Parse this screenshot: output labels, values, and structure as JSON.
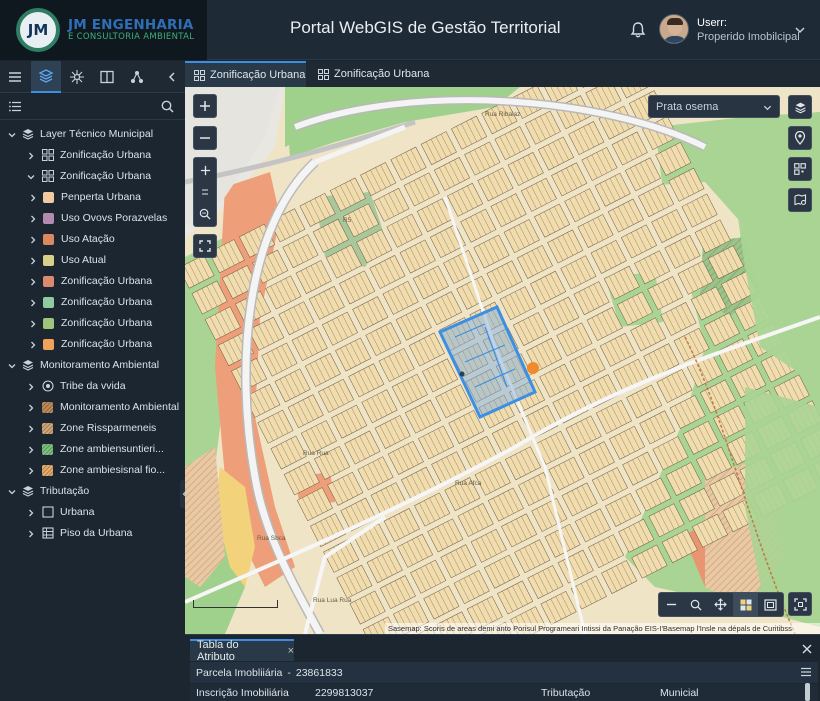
{
  "app": {
    "logo_title": "JM ENGENHARIA",
    "logo_subtitle": "E CONSULTORIA AMBIENTAL",
    "logo_initials": "JM",
    "title": "Portal WebGIS de Gestão Territorial"
  },
  "user": {
    "name": "Userr:",
    "role": "Properido Imobilcipal"
  },
  "tabs": [
    {
      "label": "Zonificação Urbana",
      "active": true
    },
    {
      "label": "Zonificação Urbana",
      "active": false
    }
  ],
  "toolbar": {
    "icons": [
      "menu-icon",
      "layers-icon",
      "network-icon",
      "split-view-icon",
      "tree-icon",
      "collapse-left-icon"
    ]
  },
  "layers": [
    {
      "label": "Layer Técnico Municipal",
      "level": 0,
      "expanded": true,
      "icon": "stack-icon"
    },
    {
      "label": "Zonificação Urbana",
      "level": 1,
      "expanded": false,
      "icon": "grid-icon"
    },
    {
      "label": "Zonificação Urbana",
      "level": 1,
      "expanded": true,
      "icon": "grid-icon"
    },
    {
      "label": "Penperta Urbana",
      "level": 2,
      "color": "#f2c9a0"
    },
    {
      "label": "Uso Ovovs Porazvelas",
      "level": 2,
      "color": "#b48ab0"
    },
    {
      "label": "Uso Atação",
      "level": 2,
      "color": "#d9895f"
    },
    {
      "label": "Uso Atual",
      "level": 2,
      "color": "#d8cf8a"
    },
    {
      "label": "Zonificação Urbana",
      "level": 2,
      "color": "#d98a6f"
    },
    {
      "label": "Zonificação Urbana",
      "level": 2,
      "color": "#8fcaa2"
    },
    {
      "label": "Zonificação Urbana",
      "level": 2,
      "color": "#9ec57a"
    },
    {
      "label": "Zonificação Urbana",
      "level": 2,
      "color": "#f0a25a"
    },
    {
      "label": "Monitoramento Ambiental",
      "level": 0,
      "expanded": true,
      "icon": "stack-icon"
    },
    {
      "label": "Tribe da vvida",
      "level": 1,
      "icon": "target-icon"
    },
    {
      "label": "Monitoramento Ambiental",
      "level": 1,
      "color": "#c0895a",
      "hatched": true
    },
    {
      "label": "Zone Rissparmeneis",
      "level": 1,
      "color": "#d2a777",
      "hatched": true
    },
    {
      "label": "Zone ambiensuntieri...",
      "level": 1,
      "color": "#7cc27f",
      "hatched": true
    },
    {
      "label": "Zone ambiesisnal fio...",
      "level": 1,
      "color": "#e6ad6b",
      "hatched": true
    },
    {
      "label": "Tributação",
      "level": 0,
      "expanded": true,
      "icon": "stack-icon"
    },
    {
      "label": "Urbana",
      "level": 1,
      "icon": "square-icon"
    },
    {
      "label": "Piso da Urbana",
      "level": 1,
      "icon": "table-icon"
    }
  ],
  "map": {
    "basemap_value": "Prata osema",
    "attribution": "Sasemap: Scoris de areas demi anto Porisul Programeari Intissi da Panação EIS-I'Basemap l'Insle na dépals de Curitibss",
    "labels": [
      "R5",
      "Rua Ribalaz",
      "Rua Rua",
      "Rua Afca",
      "Rua Sbca",
      "Rua Lua Rua"
    ]
  },
  "attribute_table": {
    "tab_label": "Tabla do Atributo",
    "header_label": "Parcela Imobliiária",
    "header_value": "23861833",
    "row": {
      "field1_label": "Inscrição Imobiliária",
      "field1_value": "2299813037",
      "field2_label": "Tributação",
      "field2_value": "Municial"
    }
  }
}
